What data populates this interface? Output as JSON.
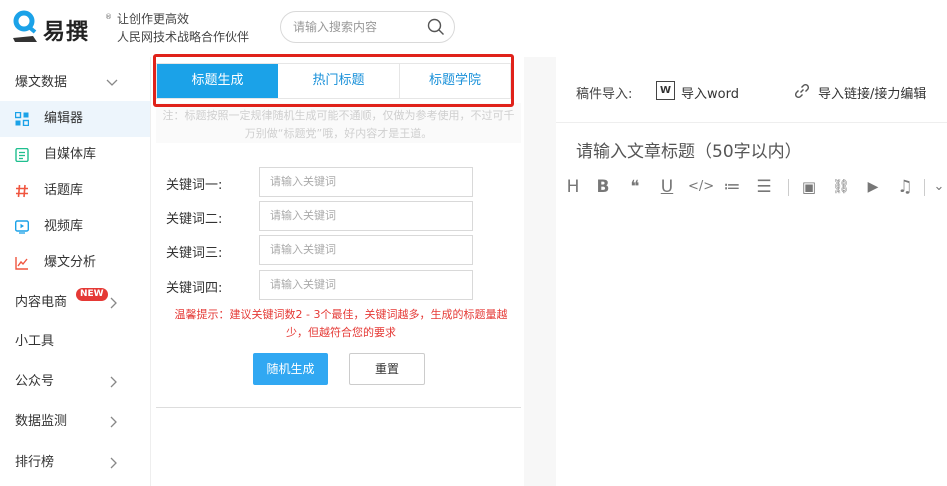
{
  "header": {
    "logo_text": "易撰",
    "logo_reg": "®",
    "slogan_line1": "让创作更高效",
    "slogan_line2": "人民网技术战略合作伙伴",
    "search_placeholder": "请输入搜索内容"
  },
  "sidebar": {
    "items": [
      {
        "label": "爆文数据",
        "level": "top",
        "chevron": "down"
      },
      {
        "label": "编辑器",
        "level": "sub",
        "icon": "grid-icon",
        "active": true
      },
      {
        "label": "自媒体库",
        "level": "sub",
        "icon": "document-icon"
      },
      {
        "label": "话题库",
        "level": "sub",
        "icon": "hashtag-icon"
      },
      {
        "label": "视频库",
        "level": "sub",
        "icon": "video-icon"
      },
      {
        "label": "爆文分析",
        "level": "sub",
        "icon": "trend-icon"
      },
      {
        "label": "内容电商",
        "level": "top",
        "chevron": "right",
        "badge": "NEW"
      },
      {
        "label": "小工具",
        "level": "top"
      },
      {
        "label": "公众号",
        "level": "top",
        "chevron": "right"
      },
      {
        "label": "数据监测",
        "level": "top",
        "chevron": "right"
      },
      {
        "label": "排行榜",
        "level": "top",
        "chevron": "right"
      }
    ],
    "colors": {
      "active_bg": "#edf5fc",
      "accent": "#1ba2e8",
      "badge": "#e53935"
    }
  },
  "title_tool": {
    "tabs": [
      {
        "label": "标题生成",
        "active": true
      },
      {
        "label": "热门标题",
        "active": false
      },
      {
        "label": "标题学院",
        "active": false
      }
    ],
    "note": "注：标题按照一定规律随机生成可能不通顺，仅做为参考使用，不过可千万别做“标题党”哦，好内容才是王道。",
    "fields": [
      {
        "label": "关键词一:",
        "placeholder": "请输入关键词"
      },
      {
        "label": "关键词二:",
        "placeholder": "请输入关键词"
      },
      {
        "label": "关键词三:",
        "placeholder": "请输入关键词"
      },
      {
        "label": "关键词四:",
        "placeholder": "请输入关键词"
      }
    ],
    "tip": "温馨提示：建议关键词数2 - 3个最佳，关键词越多，生成的标题量越少，但越符合您的要求",
    "generate_button": "随机生成",
    "reset_button": "重置"
  },
  "editor": {
    "import_label": "稿件导入:",
    "word_icon_text": "W",
    "import_word": "导入word",
    "import_link": "导入链接/接力编辑",
    "title_placeholder": "请输入文章标题（50字以内）",
    "toolbar": [
      {
        "icon": "heading-icon",
        "glyph": "H"
      },
      {
        "icon": "bold-icon",
        "glyph": "B"
      },
      {
        "icon": "quote-icon",
        "glyph": "❝"
      },
      {
        "icon": "underline-icon",
        "glyph": "U"
      },
      {
        "icon": "code-icon",
        "glyph": "</>"
      },
      {
        "icon": "ordered-list-icon",
        "glyph": "≔"
      },
      {
        "icon": "bullet-list-icon",
        "glyph": "☰"
      },
      {
        "icon": "image-icon",
        "glyph": "▣"
      },
      {
        "icon": "link-icon",
        "glyph": "⛓"
      },
      {
        "icon": "video-icon",
        "glyph": "▶"
      },
      {
        "icon": "music-icon",
        "glyph": "♫"
      },
      {
        "icon": "more-icon",
        "glyph": "⌄"
      }
    ]
  }
}
